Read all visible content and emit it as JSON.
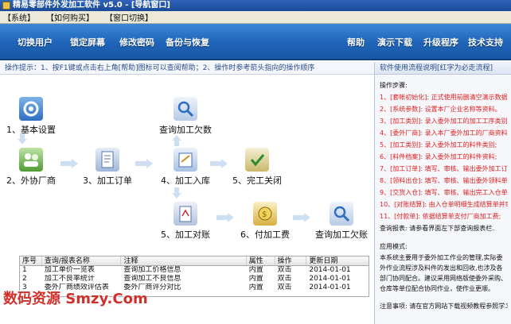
{
  "window": {
    "title": "精易零部件外发加工软件 v5.0 - [导航窗口]"
  },
  "menu": [
    "【系统】",
    "【如何购买】",
    "【窗口切换】"
  ],
  "toolbar": {
    "left": [
      "切换用户",
      "锁定屏幕",
      "修改密码",
      "备份与恢复"
    ],
    "right": [
      "帮助",
      "演示下载",
      "升级程序",
      "技术支持"
    ]
  },
  "hint": "操作提示：1、按F1键或点击右上角[帮助]图标可以查阅帮助；2、操作时参考箭头指向的操作顺序",
  "flow": {
    "nodes": [
      {
        "label": "1、基本设置",
        "icon": "settings-icon"
      },
      {
        "label": "2、外协厂商",
        "icon": "vendor-icon"
      },
      {
        "label": "3、加工订单",
        "icon": "order-icon"
      },
      {
        "label": "4、加工入库",
        "icon": "warehouse-icon"
      },
      {
        "label": "5、完工关闭",
        "icon": "checkmark-icon"
      },
      {
        "label": "查询加工欠数",
        "icon": "search-icon"
      },
      {
        "label": "5、加工对账",
        "icon": "reconcile-icon"
      },
      {
        "label": "6、付加工费",
        "icon": "payment-icon"
      },
      {
        "label": "查询加工欠账",
        "icon": "search-icon"
      }
    ]
  },
  "table": {
    "columns": [
      "序号",
      "查询/报表名称",
      "注释",
      "属性",
      "操作",
      "更新日期"
    ],
    "rows": [
      [
        "1",
        "加工单价一览表",
        "查询加工价格信息",
        "内置",
        "双击",
        "2014-01-01"
      ],
      [
        "2",
        "加工不良率统计",
        "查询加工不良信息",
        "内置",
        "双击",
        "2014-01-01"
      ],
      [
        "3",
        "委外厂商绩效评估表",
        "委外厂商评分对比",
        "内置",
        "双击",
        "2014-01-01"
      ]
    ]
  },
  "side": {
    "header": "软件使用流程说明[红字为必走流程]",
    "steps_title": "操作步骤:",
    "steps": [
      {
        "text": "1、[套帐初始化]: 正式使用前删清空演示数据;",
        "required": true
      },
      {
        "text": "2、[系统参数]: 设置本厂企业名称等资料。",
        "required": true
      },
      {
        "text": "3、[加工类别]: 录入委外加工的加工工序类别",
        "required": true
      },
      {
        "text": "4、[委外厂商]: 录入本厂委外加工的厂商资料",
        "required": true
      },
      {
        "text": "5、[加工类别]: 录入委外加工的料件类别;",
        "required": true
      },
      {
        "text": "6、[料件档案]: 录入委外加工的料件资料;",
        "required": true
      },
      {
        "text": "7、[加工订单]: 填写、审核、输出委外加工订单",
        "required": true
      },
      {
        "text": "8、[领料出仓]: 填写、审核、输出委外领料单据",
        "required": true
      },
      {
        "text": "9、[交货入仓]: 填写、审核、输出完工入仓单据",
        "required": true
      },
      {
        "text": "10、[对账结算]: 由入仓单明细生成结算单并审核",
        "required": true
      },
      {
        "text": "11、[付款单]: 依据结算单支付厂商加工费;",
        "required": true
      },
      {
        "text": "查询报表: 请参看界面左下部查询报表栏.",
        "required": false
      }
    ],
    "mode_title": "应用模式:",
    "mode_text": "本系统主要用于委外加工作业的管理,实际委外作业流程涉及料件的发出和回收,也涉及各部门协同配合。建议采用网络版使委外采购、仓库等单位配合协同作业，使作业更顺。",
    "note": "注意事项: 请在官方网站下载视频教程参照学习;"
  },
  "watermark": "数码资源 Smzy.Com"
}
